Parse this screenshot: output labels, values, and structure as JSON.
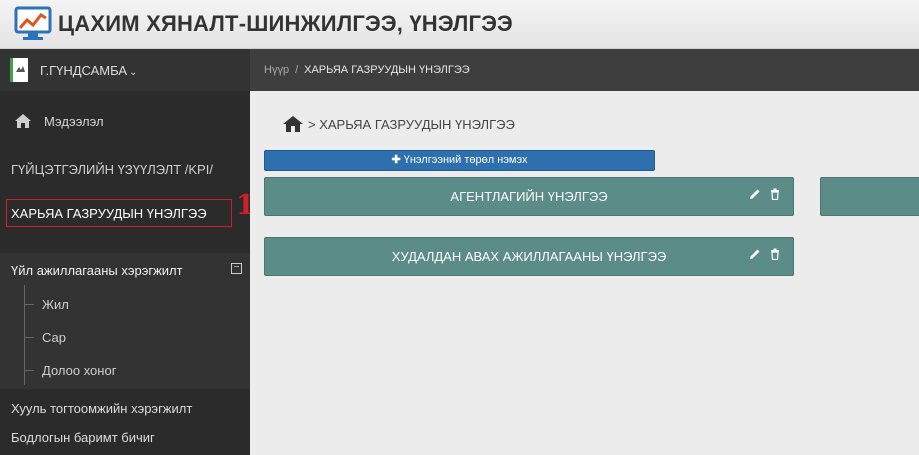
{
  "header": {
    "app_title": "ЦАХИМ ХЯНАЛТ-ШИНЖИЛГЭЭ, ҮНЭЛГЭЭ",
    "logo_icon": "monitor-chart-icon"
  },
  "sidebar": {
    "user_name": "Г.ГҮНДСАМБА",
    "user_caret": "⌄",
    "info_label": "Мэдээлэл",
    "kpi_label": "ГҮЙЦЭТГЭЛИЙН ҮЗҮҮЛЭЛТ /KPI/",
    "active_label": "ХАРЬЯА ГАЗРУУДЫН ҮНЭЛГЭЭ",
    "annotation_number": "1",
    "activity_group": {
      "label": "Үйл ажиллагааны хэрэгжилт",
      "collapse_symbol": "−",
      "items": [
        {
          "label": "Жил"
        },
        {
          "label": "Сар"
        },
        {
          "label": "Долоо хоног"
        }
      ]
    },
    "law_label": "Хууль тогтоомжийн хэрэгжилт",
    "policy_label": "Бодлогын баримт бичиг"
  },
  "breadcrumb": {
    "home": "Нүүр",
    "separator": "/",
    "current": "ХАРЬЯА ГАЗРУУДЫН ҮНЭЛГЭЭ"
  },
  "main": {
    "page_title": "> ХАРЬЯА ГАЗРУУДЫН ҮНЭЛГЭЭ",
    "add_button": {
      "plus": "✚",
      "label": "Үнэлгээний төрөл нэмэх"
    },
    "cards": [
      {
        "label": "АГЕНТЛАГИЙН ҮНЭЛГЭЭ"
      },
      {
        "label": "ХУДАЛДАН АВАХ АЖИЛЛАГААНЫ ҮНЭЛГЭЭ"
      }
    ]
  },
  "colors": {
    "accent_red": "#d21f26",
    "card_teal": "#5b8c87",
    "button_blue": "#2e6fae",
    "sidebar_bg": "#2b2b2b"
  }
}
